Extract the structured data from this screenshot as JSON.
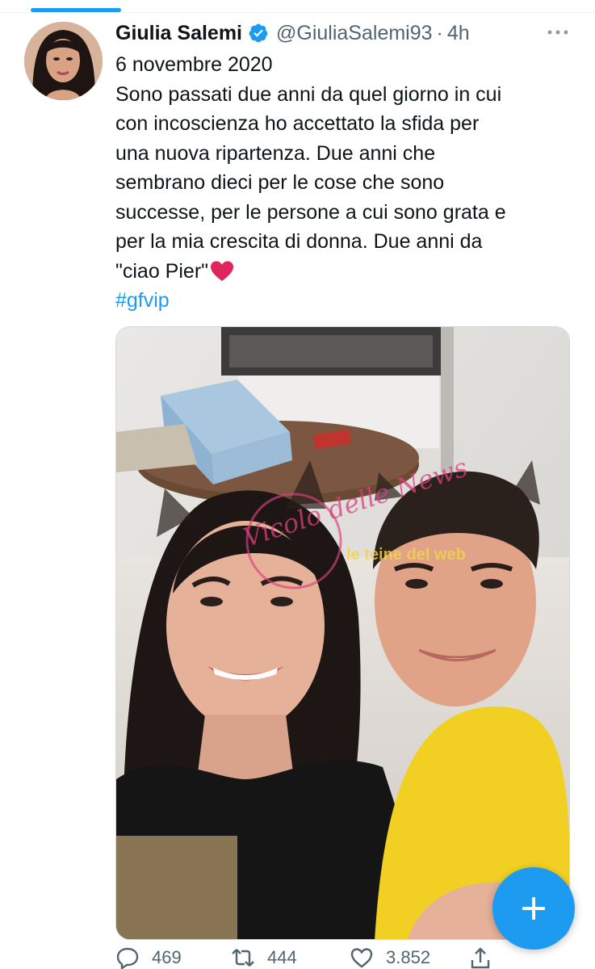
{
  "tweet": {
    "author": {
      "name": "Giulia Salemi",
      "handle": "@GiuliaSalemi93",
      "separator": "·",
      "time": "4h"
    },
    "text_lines": [
      "6 novembre 2020",
      "Sono passati due anni da quel giorno in cui",
      "con incoscienza ho accettato la sfida per",
      "una nuova ripartenza. Due anni che",
      "sembrano dieci per le cose che sono",
      "successe, per le persone a cui sono grata e",
      "per la mia crescita di donna. Due anni da",
      "\"ciao Pier\""
    ],
    "hashtag": "#gfvip",
    "media": {
      "watermark_main": "Vicolo delle News",
      "watermark_secondary": "le teine del web"
    },
    "stats": {
      "replies": "469",
      "retweets": "444",
      "likes": "3.852"
    }
  },
  "icons": {
    "verified": "verified-badge-icon",
    "more": "more-dots-icon",
    "reply": "reply-icon",
    "retweet": "retweet-icon",
    "like": "like-icon",
    "share": "share-icon",
    "compose": "plus-icon",
    "heart_emoji": "red-heart-emoji"
  },
  "colors": {
    "accent": "#1d9bf0",
    "text": "#0f1419",
    "secondary": "#536471",
    "heart": "#e0245e"
  }
}
